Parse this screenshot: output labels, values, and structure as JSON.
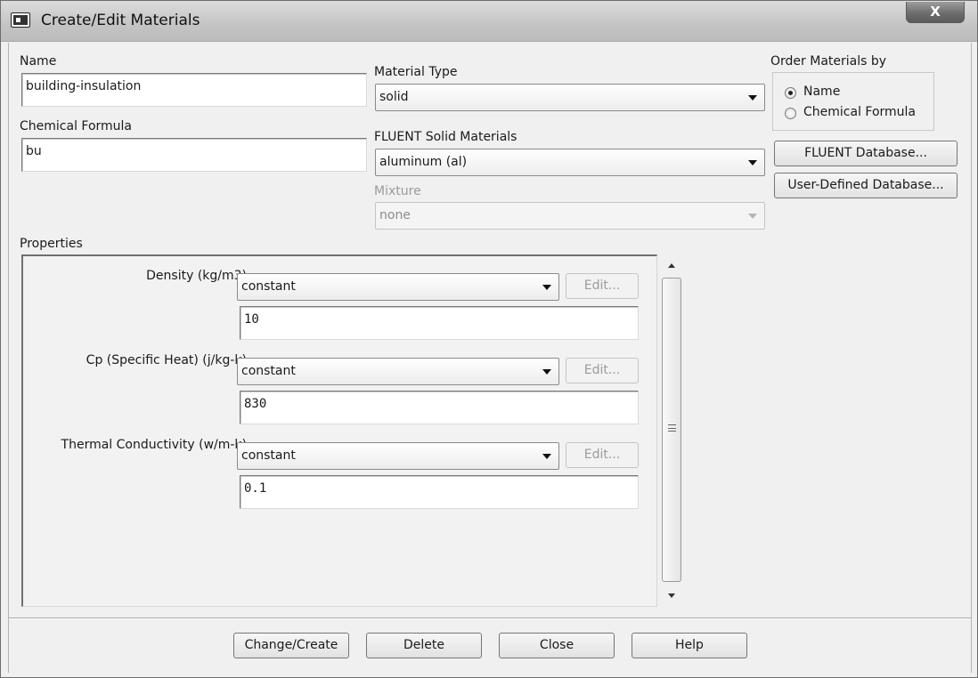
{
  "window": {
    "title": "Create/Edit Materials",
    "close_glyph": "X"
  },
  "form": {
    "name_label": "Name",
    "name_value": "building-insulation",
    "formula_label": "Chemical Formula",
    "formula_value": "bu",
    "material_type_label": "Material Type",
    "material_type_value": "solid",
    "solid_materials_label": "FLUENT Solid Materials",
    "solid_materials_value": "aluminum (al)",
    "mixture_label": "Mixture",
    "mixture_value": "none"
  },
  "order": {
    "label": "Order Materials by",
    "options": [
      {
        "label": "Name",
        "checked": true
      },
      {
        "label": "Chemical Formula",
        "checked": false
      }
    ]
  },
  "database_buttons": {
    "fluent": "FLUENT Database...",
    "user": "User-Defined Database..."
  },
  "properties": {
    "label": "Properties",
    "items": [
      {
        "label": "Density (kg/m3)",
        "method": "constant",
        "edit": "Edit...",
        "value": "10"
      },
      {
        "label": "Cp (Specific Heat) (j/kg-k)",
        "method": "constant",
        "edit": "Edit...",
        "value": "830"
      },
      {
        "label": "Thermal Conductivity (w/m-k)",
        "method": "constant",
        "edit": "Edit...",
        "value": "0.1"
      }
    ]
  },
  "footer": {
    "change_create": "Change/Create",
    "delete": "Delete",
    "close": "Close",
    "help": "Help"
  }
}
